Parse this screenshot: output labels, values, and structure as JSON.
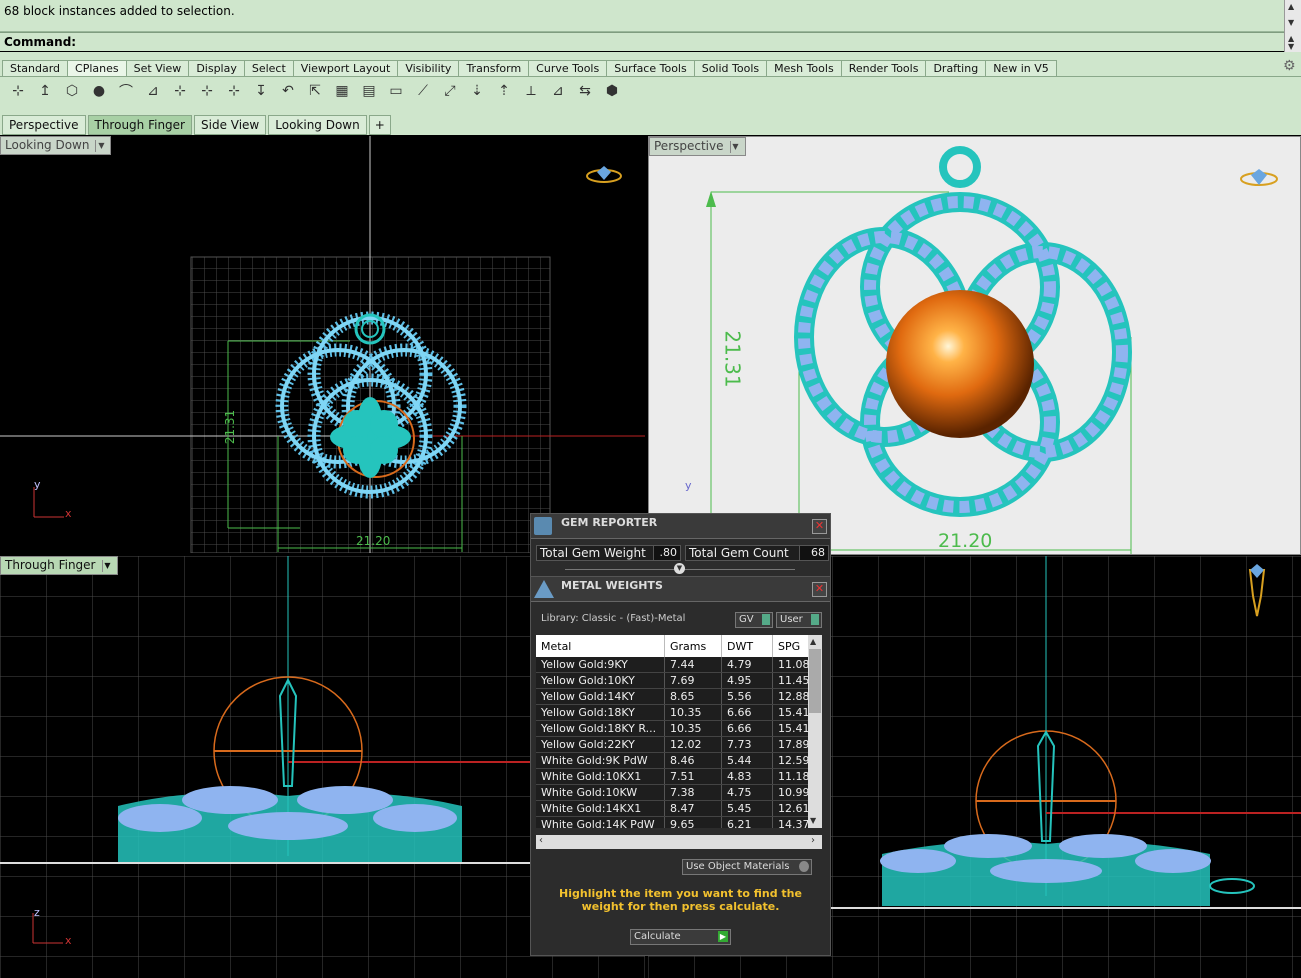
{
  "command": {
    "history": "68 block instances added to selection.",
    "prompt": "Command:"
  },
  "toolbar": {
    "tabs": [
      "Standard",
      "CPlanes",
      "Set View",
      "Display",
      "Select",
      "Viewport Layout",
      "Visibility",
      "Transform",
      "Curve Tools",
      "Surface Tools",
      "Solid Tools",
      "Mesh Tools",
      "Render Tools",
      "Drafting",
      "New in V5"
    ],
    "active_tab": "CPlanes",
    "icons": [
      "cplane-world-top-icon",
      "cplane-elevation-icon",
      "cplane-object-icon",
      "cplane-sphere-icon",
      "cplane-curve-icon",
      "cplane-3point-icon",
      "cplane-xaxis-icon",
      "cplane-zaxis-icon",
      "cplane-view-icon",
      "cplane-vertical-icon",
      "cplane-undo-icon",
      "cplane-select-icon",
      "grid-icon",
      "save-cplane-icon",
      "open-cplane-icon",
      "cplane-surface-icon",
      "cplane-rotate-icon",
      "cplane-move-icon",
      "cplane-up-icon",
      "cplane-orient-icon",
      "cplane-set-icon",
      "cplane-prev-next-icon",
      "cplane-standard-icon"
    ]
  },
  "viewport_tabs": [
    "Perspective",
    "Through Finger",
    "Side View",
    "Looking Down",
    "+"
  ],
  "active_viewport_tab": "Through Finger",
  "viewports": {
    "top_left": {
      "label": "Looking Down",
      "dim_vertical": "21.31",
      "dim_horizontal": "21.20",
      "axis_y": "y",
      "axis_x": "x"
    },
    "top_right": {
      "label": "Perspective",
      "dim_vertical": "21.31",
      "dim_horizontal": "21.20",
      "axis_y": "y"
    },
    "bottom_left": {
      "label": "Through Finger",
      "axis_z": "z",
      "axis_x": "x"
    }
  },
  "gem_reporter": {
    "title": "GEM REPORTER",
    "total_weight_label": "Total Gem Weight",
    "total_weight_value": ".80",
    "total_count_label": "Total Gem Count",
    "total_count_value": "68"
  },
  "metal_weights": {
    "title": "METAL WEIGHTS",
    "library": "Library: Classic - (Fast)-Metal",
    "gv_label": "GV",
    "user_label": "User",
    "columns": [
      "Metal",
      "Grams",
      "DWT",
      "SPG"
    ],
    "rows": [
      [
        "Yellow Gold:9KY",
        "7.44",
        "4.79",
        "11.08"
      ],
      [
        "Yellow Gold:10KY",
        "7.69",
        "4.95",
        "11.45"
      ],
      [
        "Yellow Gold:14KY",
        "8.65",
        "5.56",
        "12.88"
      ],
      [
        "Yellow Gold:18KY",
        "10.35",
        "6.66",
        "15.41"
      ],
      [
        "Yellow Gold:18KY R...",
        "10.35",
        "6.66",
        "15.41"
      ],
      [
        "Yellow Gold:22KY",
        "12.02",
        "7.73",
        "17.89"
      ],
      [
        "White Gold:9K PdW",
        "8.46",
        "5.44",
        "12.59"
      ],
      [
        "White Gold:10KX1",
        "7.51",
        "4.83",
        "11.18"
      ],
      [
        "White Gold:10KW",
        "7.38",
        "4.75",
        "10.99"
      ],
      [
        "White Gold:14KX1",
        "8.47",
        "5.45",
        "12.61"
      ],
      [
        "White Gold:14K PdW",
        "9.65",
        "6.21",
        "14.37"
      ]
    ],
    "use_object_materials": "Use Object Materials",
    "hint": "Highlight the item you want to find the weight for then press calculate.",
    "calculate": "Calculate"
  },
  "colors": {
    "cmd_bg": "#cfe6cc",
    "model_cyan": "#25c4bd",
    "gem_blue": "#8fb4f0",
    "ring_orange": "#d86a1c",
    "hint_yellow": "#f2c12e"
  }
}
